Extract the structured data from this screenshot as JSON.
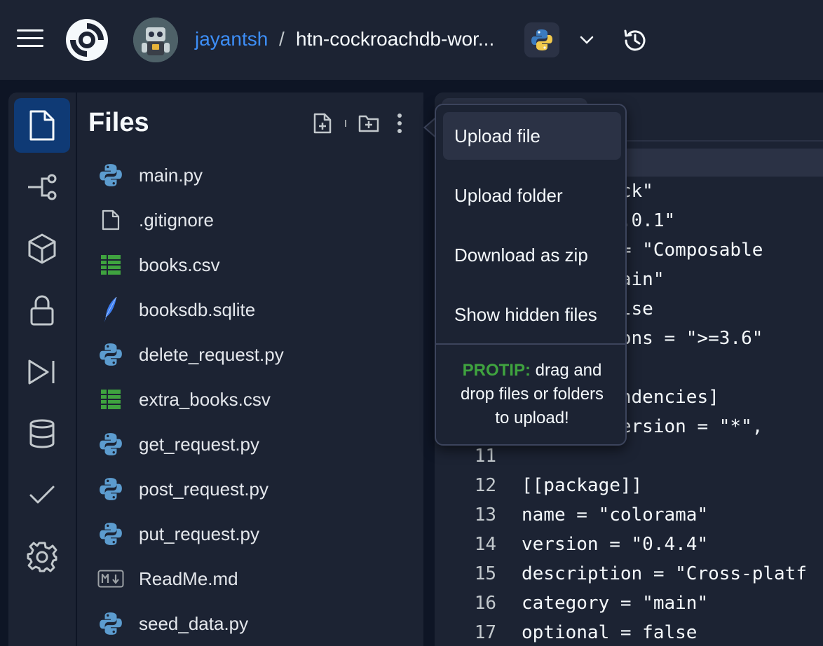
{
  "header": {
    "owner": "jayantsh",
    "separator": "/",
    "repl_name": "htn-cockroachdb-wor..."
  },
  "sidebar": {
    "items": [
      {
        "icon": "file-icon",
        "active": true
      },
      {
        "icon": "git-branch-icon"
      },
      {
        "icon": "package-cube-icon"
      },
      {
        "icon": "lock-icon"
      },
      {
        "icon": "play-run-icon"
      },
      {
        "icon": "database-icon"
      },
      {
        "icon": "checkmark-icon"
      },
      {
        "icon": "gear-icon"
      }
    ]
  },
  "files_panel": {
    "title": "Files",
    "files": [
      {
        "name": "main.py",
        "type": "python"
      },
      {
        "name": ".gitignore",
        "type": "text"
      },
      {
        "name": "books.csv",
        "type": "csv"
      },
      {
        "name": "booksdb.sqlite",
        "type": "sqlite"
      },
      {
        "name": "delete_request.py",
        "type": "python"
      },
      {
        "name": "extra_books.csv",
        "type": "csv"
      },
      {
        "name": "get_request.py",
        "type": "python"
      },
      {
        "name": "post_request.py",
        "type": "python"
      },
      {
        "name": "put_request.py",
        "type": "python"
      },
      {
        "name": "ReadMe.md",
        "type": "markdown"
      },
      {
        "name": "seed_data.py",
        "type": "python"
      }
    ]
  },
  "menu": {
    "items": [
      "Upload file",
      "Upload folder",
      "Download as zip",
      "Show hidden files"
    ],
    "protip_keyword": "PROTIP:",
    "protip_line1": "drag and",
    "protip_line2": "drop files or folders",
    "protip_line3": "to upload!"
  },
  "editor": {
    "lines": [
      {
        "num": "",
        "text": "       ]]"
      },
      {
        "num": "",
        "text": "       lick\""
      },
      {
        "num": "",
        "text": "     = \"8.0.1\""
      },
      {
        "num": "",
        "text": "      on = \"Composable"
      },
      {
        "num": "",
        "text": "     = \"main\""
      },
      {
        "num": "",
        "text": "     = false"
      },
      {
        "num": "",
        "text": "      rsions = \">=3.6\""
      },
      {
        "num": "",
        "text": ""
      },
      {
        "num": "",
        "text": "     dependencies]"
      },
      {
        "num": "",
        "text": "     = {version = \"*\","
      },
      {
        "num": "11",
        "text": ""
      },
      {
        "num": "12",
        "text": "[[package]]"
      },
      {
        "num": "13",
        "text": "name = \"colorama\""
      },
      {
        "num": "14",
        "text": "version = \"0.4.4\""
      },
      {
        "num": "15",
        "text": "description = \"Cross-platf"
      },
      {
        "num": "16",
        "text": "category = \"main\""
      },
      {
        "num": "17",
        "text": "optional = false"
      }
    ]
  }
}
